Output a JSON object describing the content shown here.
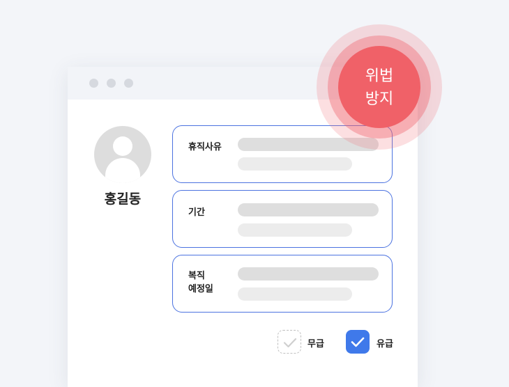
{
  "profile": {
    "name": "홍길동"
  },
  "form": {
    "fields": [
      {
        "label": "휴직사유"
      },
      {
        "label": "기간"
      },
      {
        "label_lines": [
          "복직",
          "예정일"
        ]
      }
    ],
    "options": [
      {
        "label": "무급",
        "checked": false
      },
      {
        "label": "유급",
        "checked": true
      }
    ]
  },
  "badge": {
    "line1": "위법",
    "line2": "방지"
  },
  "colors": {
    "accent": "#3f79ea",
    "badge": "#f06168",
    "card_border": "#4b72e0"
  },
  "icons": {
    "window_controls": [
      "window-dot-icon",
      "window-dot-icon",
      "window-dot-icon"
    ],
    "avatar": "user-avatar-icon",
    "check": "check-icon"
  }
}
